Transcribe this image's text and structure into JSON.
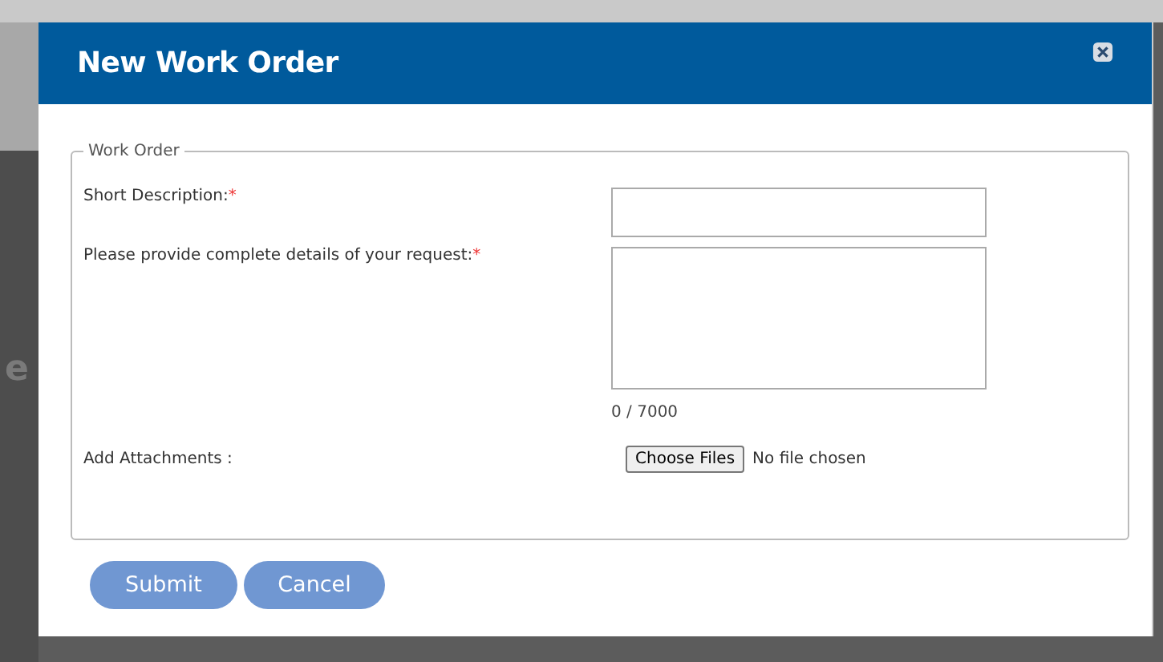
{
  "background": {
    "text": "e"
  },
  "dialog": {
    "title": "New Work Order",
    "fieldset": {
      "legend": "Work Order",
      "fields": [
        {
          "kind": "text",
          "label": "Short Description:",
          "required_mark": "*"
        },
        {
          "kind": "textarea",
          "label": "Please provide complete details of your request:",
          "required_mark": "*",
          "counter": "0 / 7000"
        },
        {
          "kind": "file",
          "label": "Add Attachments :",
          "button": "Choose Files",
          "status": "No file chosen"
        }
      ]
    },
    "buttons": [
      "Submit",
      "Cancel"
    ]
  }
}
